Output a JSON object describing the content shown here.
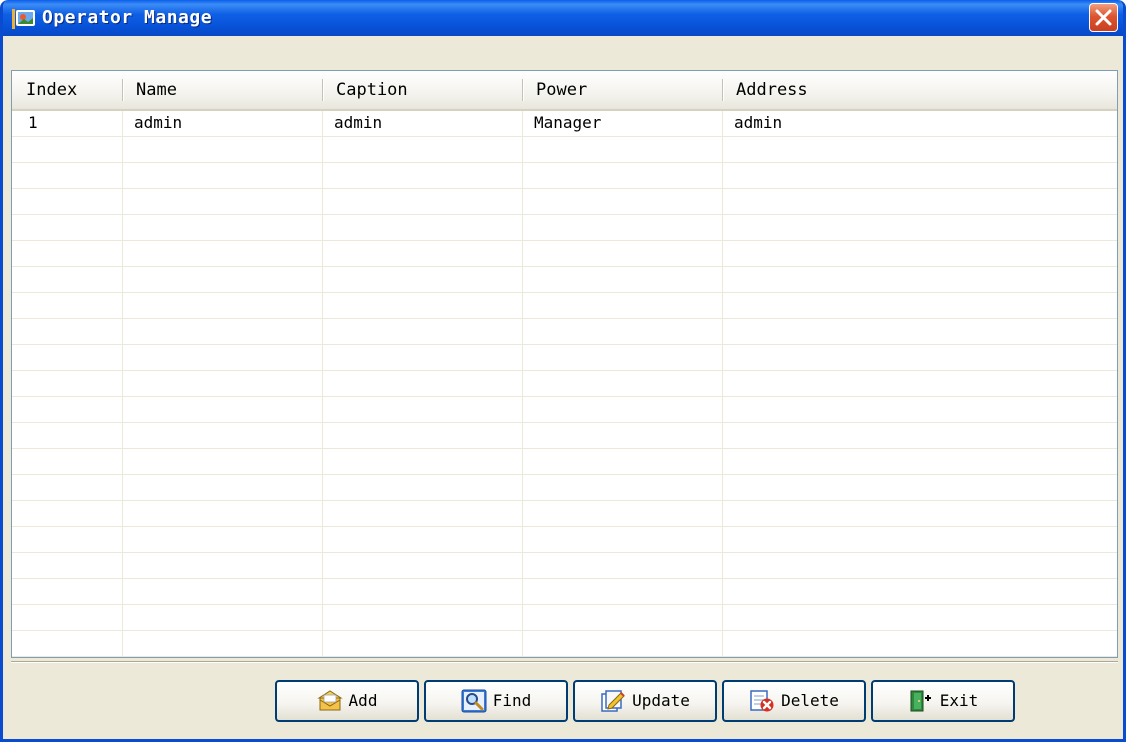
{
  "window": {
    "title": "Operator Manage"
  },
  "grid": {
    "columns": [
      "Index",
      "Name",
      "Caption",
      "Power",
      "Address"
    ],
    "rows": [
      [
        "1",
        "admin",
        "admin",
        "Manager",
        "admin"
      ]
    ]
  },
  "buttons": {
    "add": {
      "label": "Add",
      "icon": "add-folder-icon"
    },
    "find": {
      "label": "Find",
      "icon": "magnifier-icon"
    },
    "update": {
      "label": "Update",
      "icon": "edit-pencil-icon"
    },
    "delete": {
      "label": "Delete",
      "icon": "delete-x-icon"
    },
    "exit": {
      "label": "Exit",
      "icon": "exit-door-icon"
    }
  },
  "colors": {
    "titlebar": "#0a5ee8",
    "window_bg": "#ece9d8",
    "close": "#dd5530"
  }
}
